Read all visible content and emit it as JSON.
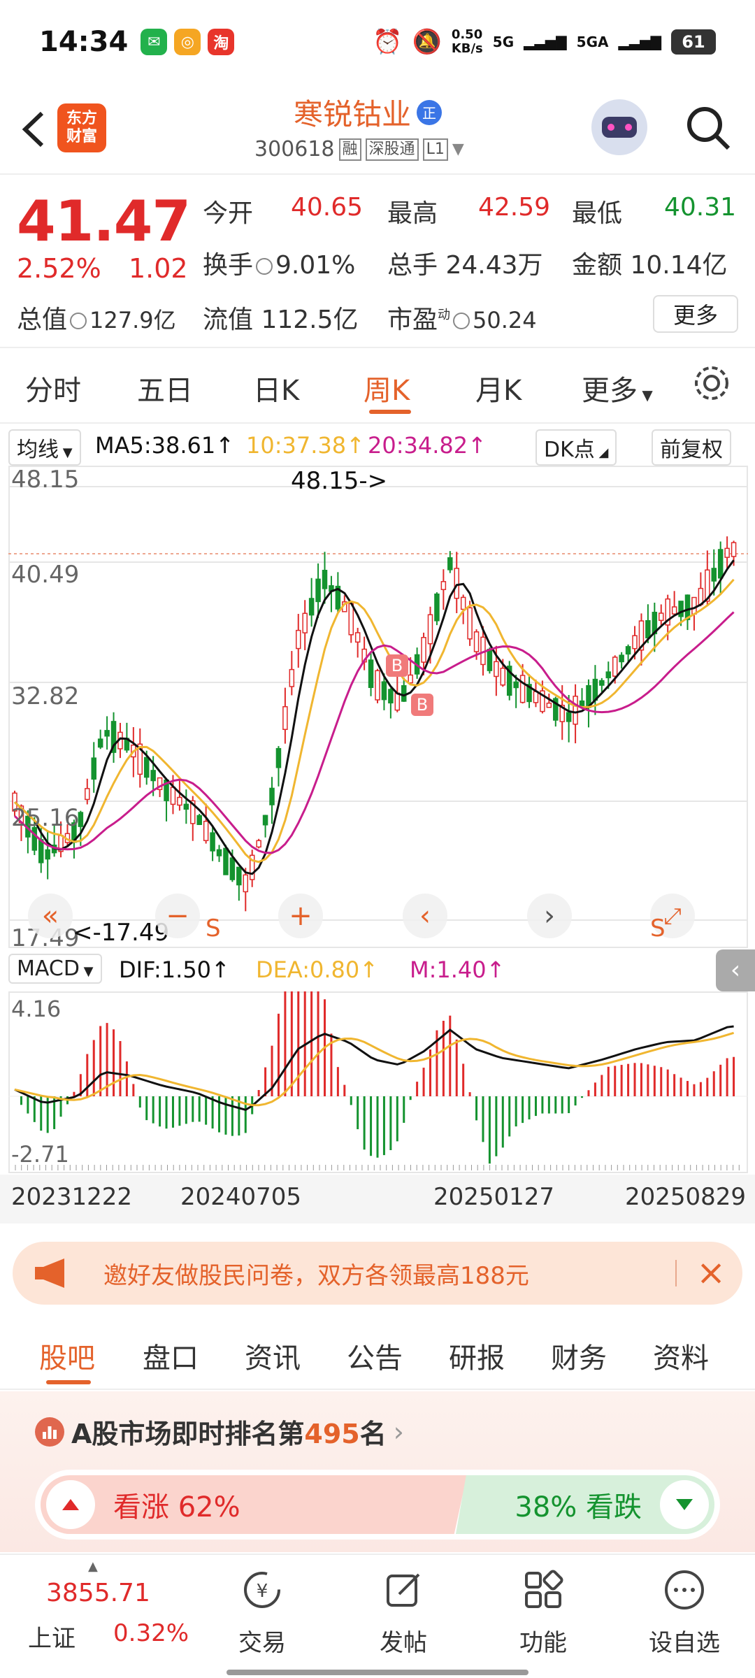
{
  "status_bar": {
    "time": "14:34",
    "net_speed_value": "0.50",
    "net_speed_unit": "KB/s",
    "signal_5g": "5G",
    "signal_5ga": "5GA",
    "battery": "61"
  },
  "header": {
    "back_icon": "chevron-left-icon",
    "logo_line1": "东方",
    "logo_line2": "财富",
    "stock_name": "寒锐钴业",
    "badge": "正",
    "stock_code": "300618",
    "tag_rong": "融",
    "tag_sgt": "深股通",
    "tag_l1": "L1"
  },
  "quote": {
    "price": "41.47",
    "change_pct": "2.52%",
    "change_amt": "1.02",
    "open_label": "今开",
    "open": "40.65",
    "high_label": "最高",
    "high": "42.59",
    "low_label": "最低",
    "low": "40.31",
    "turnover_label": "换手",
    "turnover": "9.01%",
    "volume_label": "总手",
    "volume": "24.43万",
    "amount_label": "金额",
    "amount": "10.14亿",
    "mktcap_label": "总值",
    "mktcap": "127.9亿",
    "float_label": "流值",
    "float": "112.5亿",
    "pe_label": "市盈",
    "pe_sup": "动",
    "pe": "50.24",
    "more_label": "更多"
  },
  "period_tabs": [
    "分时",
    "五日",
    "日K",
    "周K",
    "月K",
    "更多"
  ],
  "active_period": "周K",
  "ma_row": {
    "select": "均线",
    "ma5": "MA5:38.61",
    "ma10": "10:37.38",
    "ma20": "20:34.82",
    "dk": "DK点",
    "adjust": "前复权"
  },
  "main_chart_labels": {
    "y1": "48.15",
    "y2": "40.49",
    "y3": "32.82",
    "y4": "25.16",
    "y5": "17.49",
    "max_note": "48.15->",
    "min_note": "<-17.49",
    "signal_b": "B",
    "signal_s": "S"
  },
  "macd_row": {
    "select": "MACD",
    "dif": "DIF:1.50",
    "dea": "DEA:0.80",
    "m": "M:1.40"
  },
  "macd_labels": {
    "y_top": "4.16",
    "y_bottom": "-2.71"
  },
  "dates": [
    "20231222",
    "20240705",
    "20250127",
    "20250829"
  ],
  "promo": {
    "text": "邀好友做股民问卷，双方各领最高188元"
  },
  "section_tabs": [
    "股吧",
    "盘口",
    "资讯",
    "公告",
    "研报",
    "财务",
    "资料"
  ],
  "rank": {
    "prefix": "A股市场即时排名第",
    "number": "495",
    "suffix": "名"
  },
  "vote": {
    "up_label": "看涨",
    "up_pct": "62%",
    "down_pct": "38%",
    "down_label": "看跌"
  },
  "bottom": {
    "index_value": "3855.71",
    "index_name": "上证",
    "index_pct": "0.32%",
    "tabs": [
      "交易",
      "发帖",
      "功能",
      "设自选"
    ]
  },
  "colors": {
    "up": "#e02a2a",
    "down": "#14932f",
    "accent": "#e4622b",
    "ma5": "#111111",
    "ma10": "#f0b630",
    "ma20": "#c81d8c"
  },
  "chart_data": {
    "type": "candlestick",
    "interval": "weekly",
    "ylim": [
      17.49,
      48.15
    ],
    "ma_lines": [
      "MA5",
      "MA10",
      "MA20"
    ],
    "macd_ylim": [
      -2.71,
      4.16
    ],
    "x_ticks": [
      "20231222",
      "20240705",
      "20250127",
      "20250829"
    ]
  }
}
